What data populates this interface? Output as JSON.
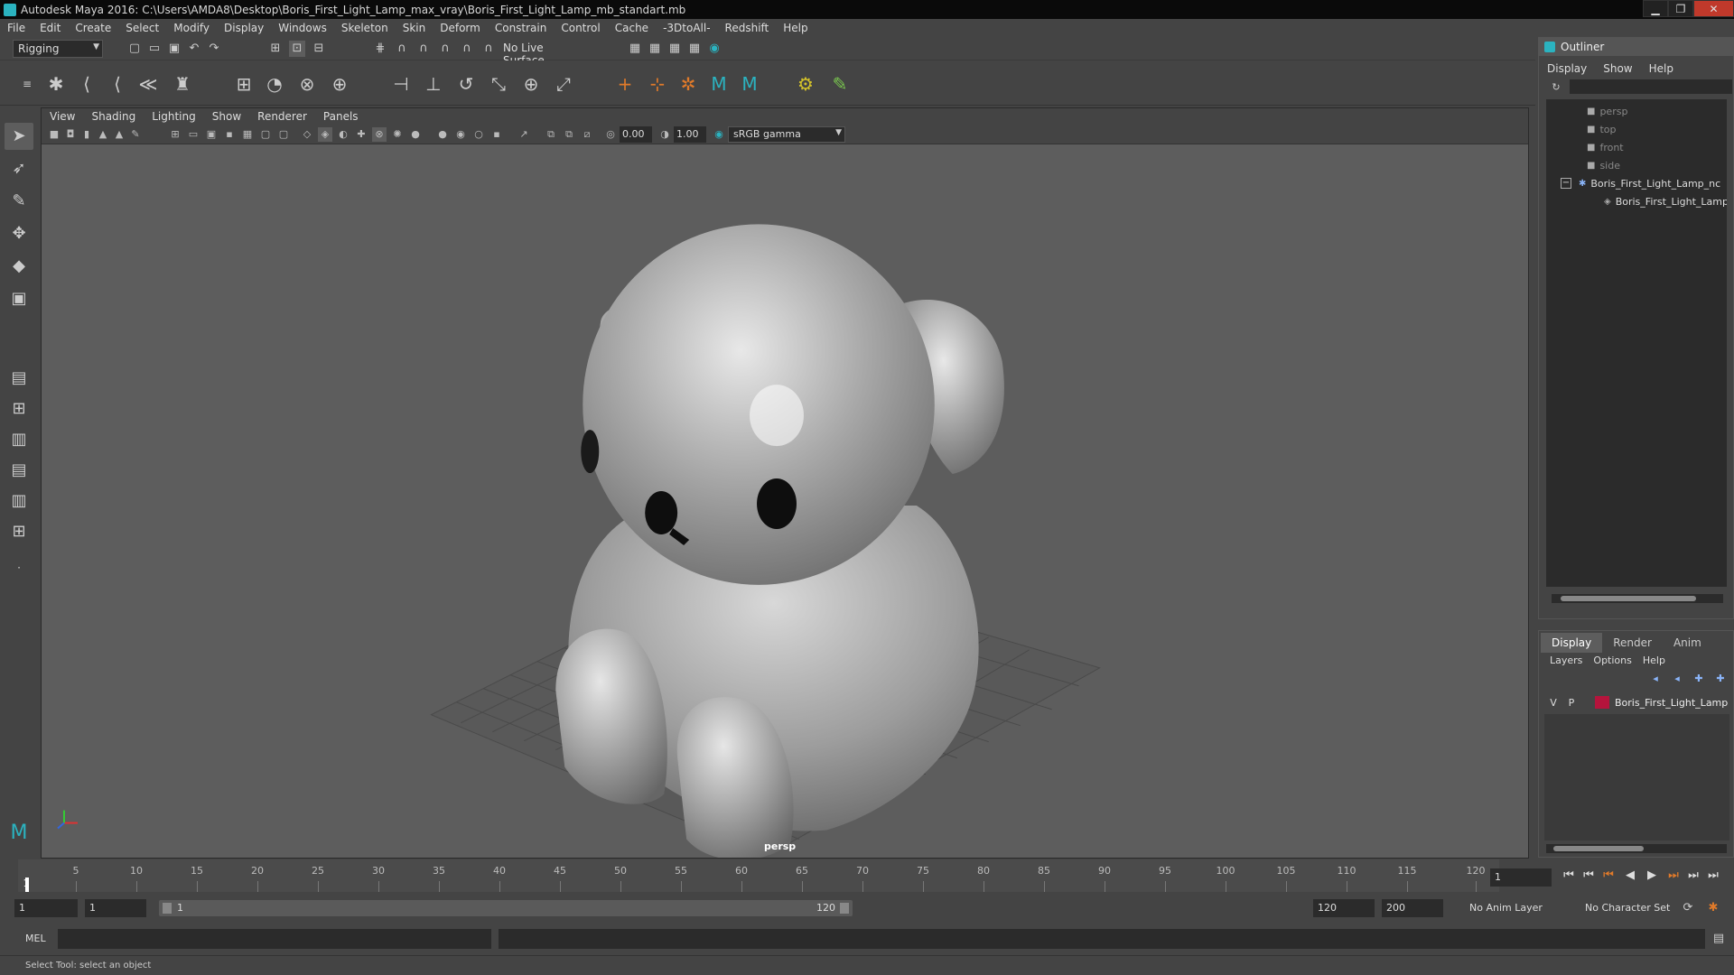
{
  "title_bar": {
    "title": "Autodesk Maya 2016: C:\\Users\\AMDA8\\Desktop\\Boris_First_Light_Lamp_max_vray\\Boris_First_Light_Lamp_mb_standart.mb",
    "minimize": "▁",
    "maximize": "❐",
    "close": "✕"
  },
  "menu": [
    "File",
    "Edit",
    "Create",
    "Select",
    "Modify",
    "Display",
    "Windows",
    "Skeleton",
    "Skin",
    "Deform",
    "Constrain",
    "Control",
    "Cache",
    "-3DtoAll-",
    "Redshift",
    "Help"
  ],
  "status_line": {
    "mode": "Rigging",
    "live_surface": "No Live Surface"
  },
  "viewport": {
    "menu": [
      "View",
      "Shading",
      "Lighting",
      "Show",
      "Renderer",
      "Panels"
    ],
    "exposure": "0.00",
    "gamma": "1.00",
    "color_space": "sRGB gamma",
    "camera": "persp"
  },
  "outliner": {
    "title": "Outliner",
    "menu": [
      "Display",
      "Show",
      "Help"
    ],
    "nodes": [
      "persp",
      "top",
      "front",
      "side",
      "Boris_First_Light_Lamp_nc",
      "Boris_First_Light_Lamp"
    ],
    "collapse_sign": "−"
  },
  "layers": {
    "tabs": [
      "Display",
      "Render",
      "Anim"
    ],
    "menu": [
      "Layers",
      "Options",
      "Help"
    ],
    "row": {
      "v": "V",
      "p": "P",
      "name": "Boris_First_Light_Lamp",
      "color": "#b5143c"
    }
  },
  "timeline": {
    "ticks": [
      "5",
      "10",
      "15",
      "20",
      "25",
      "30",
      "35",
      "40",
      "45",
      "50",
      "55",
      "60",
      "65",
      "70",
      "75",
      "80",
      "85",
      "90",
      "95",
      "100",
      "105",
      "110",
      "115",
      "120"
    ],
    "current_marker": "1",
    "current_frame": "1"
  },
  "range": {
    "start": "1",
    "start2": "1",
    "slider_start": "1",
    "slider_end": "120",
    "end": "120",
    "end2": "200",
    "anim_layer": "No Anim Layer",
    "char_set": "No Character Set"
  },
  "command_line": {
    "lang": "MEL"
  },
  "help_line": {
    "text": "Select Tool: select an object"
  }
}
